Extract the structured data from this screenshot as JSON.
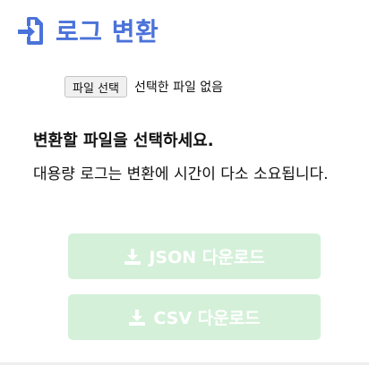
{
  "header": {
    "title": "로그 변환",
    "icon": "file-import-icon",
    "accent_color": "#4a72d9"
  },
  "file_picker": {
    "button_label": "파일 선택",
    "status_text": "선택한 파일 없음"
  },
  "instruction": "변환할 파일을 선택하세요.",
  "note": "대용량 로그는 변환에 시간이 다소 소요됩니다.",
  "downloads": {
    "json_label": "JSON 다운로드",
    "csv_label": "CSV 다운로드",
    "icon": "download-icon",
    "state": "disabled",
    "button_color": "#d4f0d9"
  }
}
